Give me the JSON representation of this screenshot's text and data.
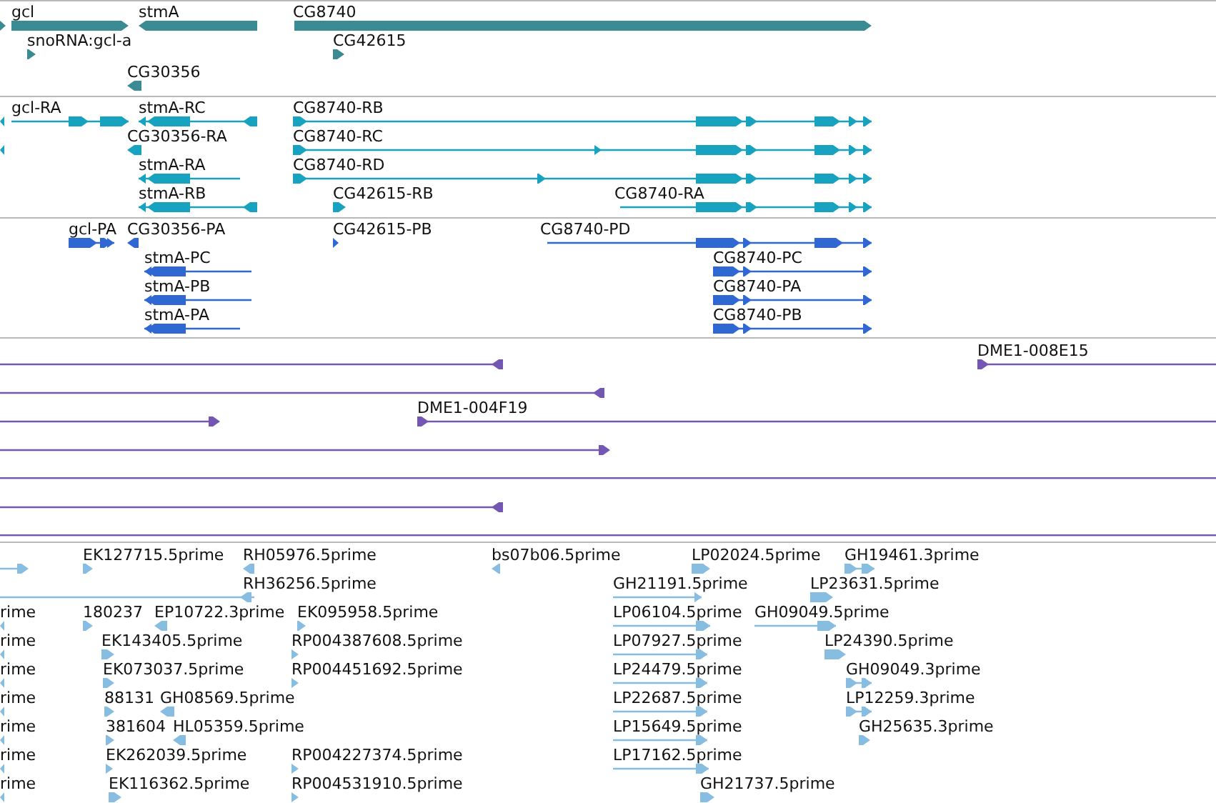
{
  "tracks": [
    {
      "kind": "gene",
      "color": "#3b8b94",
      "features": [
        {
          "reverse": false
        },
        {
          "label": "gcl",
          "reverse": false
        },
        {
          "label": "stmA",
          "reverse": true
        },
        {
          "label": "CG8740",
          "reverse": false
        },
        {
          "label": "snoRNA:gcl-a",
          "reverse": false
        },
        {
          "label": "CG42615",
          "reverse": false
        },
        {
          "label": "CG30356",
          "reverse": true
        }
      ]
    },
    {
      "kind": "transcript",
      "color": "#17a3bf",
      "features": [
        {
          "reverse": true
        },
        {
          "label": "gcl-RA",
          "reverse": false
        },
        {
          "label": "stmA-RC",
          "reverse": true
        },
        {
          "label": "CG8740-RB",
          "reverse": false
        },
        {
          "reverse": true
        },
        {
          "label": "CG30356-RA",
          "reverse": true
        },
        {
          "label": "CG8740-RC",
          "reverse": false
        },
        {
          "label": "stmA-RA",
          "reverse": true
        },
        {
          "label": "CG8740-RD",
          "reverse": false
        },
        {
          "label": "stmA-RB",
          "reverse": true
        },
        {
          "label": "CG42615-RB",
          "reverse": false
        },
        {
          "label": "CG8740-RA",
          "reverse": false
        }
      ]
    },
    {
      "kind": "protein",
      "color": "#2f68d3",
      "features": [
        {
          "label": "gcl-PA",
          "reverse": false
        },
        {
          "label": "CG30356-PA",
          "reverse": true
        },
        {
          "label": "CG42615-PB",
          "reverse": false
        },
        {
          "label": "CG8740-PD",
          "reverse": false
        },
        {
          "label": "stmA-PC",
          "reverse": true
        },
        {
          "label": "CG8740-PC",
          "reverse": false
        },
        {
          "label": "stmA-PB",
          "reverse": true
        },
        {
          "label": "CG8740-PA",
          "reverse": false
        },
        {
          "label": "stmA-PA",
          "reverse": true
        },
        {
          "label": "CG8740-PB",
          "reverse": false
        }
      ]
    },
    {
      "kind": "clone",
      "color": "#7457b3",
      "features": [
        {
          "reverse": true
        },
        {
          "label": "DME1-008E15",
          "reverse": false
        },
        {
          "reverse": true
        },
        {
          "reverse": false
        },
        {
          "label": "DME1-004F19",
          "reverse": false
        },
        {
          "reverse": false
        },
        {
          "reverse": true
        }
      ]
    },
    {
      "kind": "est",
      "color": "#88bde2",
      "features": [
        {
          "reverse": false
        },
        {
          "label": "EK127715.5prime",
          "reverse": false
        },
        {
          "label": "RH05976.5prime",
          "reverse": true
        },
        {
          "label": "bs07b06.5prime",
          "reverse": true
        },
        {
          "label": "LP02024.5prime",
          "reverse": false
        },
        {
          "label": "GH19461.3prime",
          "reverse": false
        },
        {
          "label": "RH36256.5prime",
          "reverse": true
        },
        {
          "label": "GH21191.5prime",
          "reverse": false
        },
        {
          "label": "LP23631.5prime",
          "reverse": false
        },
        {
          "label": "rime",
          "reverse": true
        },
        {
          "label": "180237",
          "reverse": false
        },
        {
          "label": "EP10722.3prime",
          "reverse": true
        },
        {
          "label": "EK095958.5prime",
          "reverse": false
        },
        {
          "label": "LP06104.5prime",
          "reverse": false
        },
        {
          "label": "GH09049.5prime",
          "reverse": false
        },
        {
          "label": "rime",
          "reverse": true
        },
        {
          "label": "EK143405.5prime",
          "reverse": false
        },
        {
          "label": "RP004387608.5prime",
          "reverse": false
        },
        {
          "label": "LP07927.5prime",
          "reverse": false
        },
        {
          "label": "LP24390.5prime",
          "reverse": false
        },
        {
          "label": "rime",
          "reverse": true
        },
        {
          "label": "EK073037.5prime",
          "reverse": false
        },
        {
          "label": "RP004451692.5prime",
          "reverse": false
        },
        {
          "label": "LP24479.5prime",
          "reverse": false
        },
        {
          "label": "GH09049.3prime",
          "reverse": false
        },
        {
          "label": "rime",
          "reverse": true
        },
        {
          "label": "88131",
          "reverse": false
        },
        {
          "label": "GH08569.5prime",
          "reverse": true
        },
        {
          "label": "LP22687.5prime",
          "reverse": false
        },
        {
          "label": "LP12259.3prime",
          "reverse": false
        },
        {
          "label": "rime",
          "reverse": true
        },
        {
          "label": "381604",
          "reverse": false
        },
        {
          "label": "HL05359.5prime",
          "reverse": true
        },
        {
          "label": "LP15649.5prime",
          "reverse": false
        },
        {
          "label": "GH25635.3prime",
          "reverse": false
        },
        {
          "label": "rime",
          "reverse": true
        },
        {
          "label": "EK262039.5prime",
          "reverse": false
        },
        {
          "label": "RP004227374.5prime",
          "reverse": false
        },
        {
          "label": "LP17162.5prime",
          "reverse": false
        },
        {
          "label": "rime",
          "reverse": true
        },
        {
          "label": "EK116362.5prime",
          "reverse": false
        },
        {
          "label": "RP004531910.5prime",
          "reverse": false
        },
        {
          "label": "GH21737.5prime",
          "reverse": false
        }
      ]
    }
  ]
}
